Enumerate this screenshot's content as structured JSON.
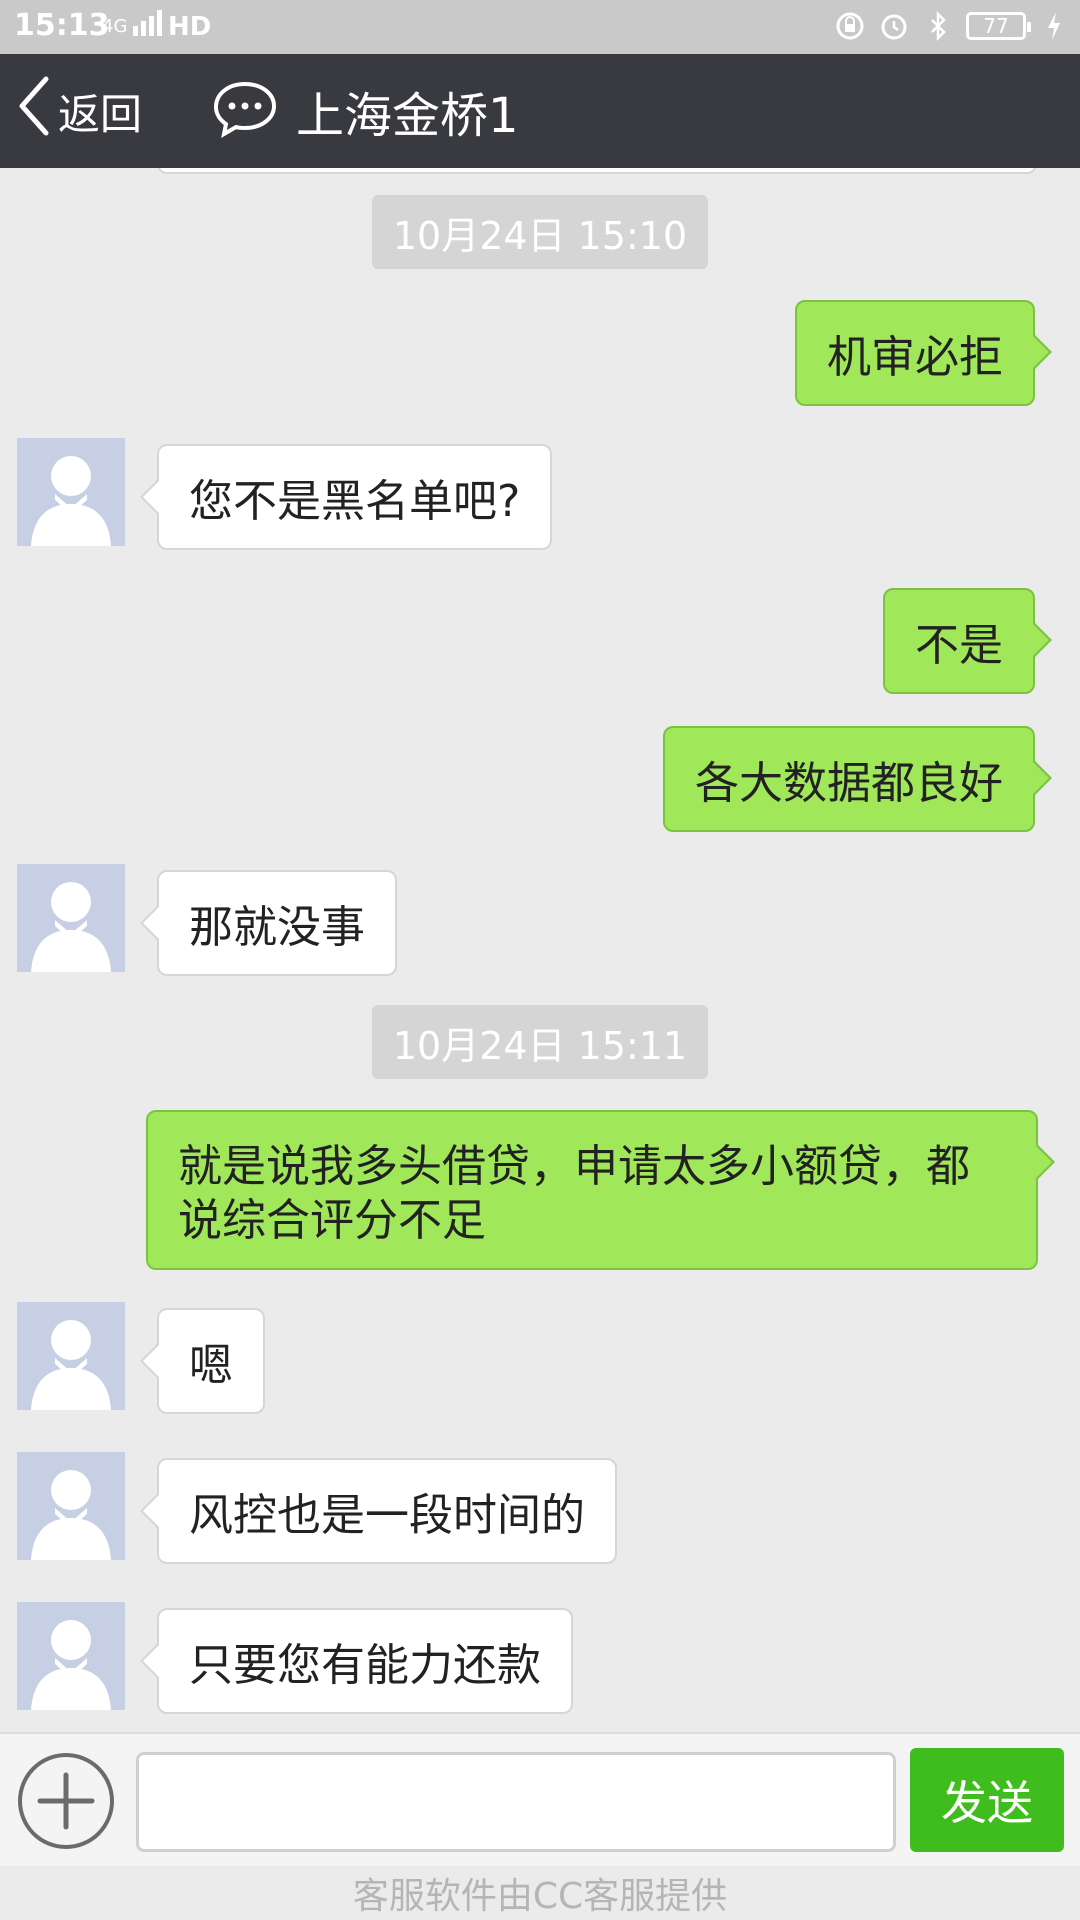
{
  "status_bar": {
    "time": "15:13",
    "network": "4G",
    "hd": "HD",
    "battery": "77"
  },
  "nav": {
    "back_label": "返回",
    "title": "上海金桥1"
  },
  "messages": [
    {
      "type": "time",
      "text": "10月24日 15:10"
    },
    {
      "type": "out",
      "text": "机审必拒"
    },
    {
      "type": "in",
      "text": "您不是黑名单吧?"
    },
    {
      "type": "out",
      "text": "不是"
    },
    {
      "type": "out",
      "text": "各大数据都良好"
    },
    {
      "type": "in",
      "text": "那就没事"
    },
    {
      "type": "time",
      "text": "10月24日 15:11"
    },
    {
      "type": "out",
      "text": "就是说我多头借贷，申请太多小额贷，都说综合评分不足"
    },
    {
      "type": "in",
      "text": "嗯"
    },
    {
      "type": "in",
      "text": "风控也是一段时间的"
    },
    {
      "type": "in",
      "text": "只要您有能力还款"
    }
  ],
  "input": {
    "value": "",
    "send_label": "发送"
  },
  "footer": {
    "text": "客服软件由CC客服提供"
  },
  "colors": {
    "nav_bg": "#393a3f",
    "outgoing_bubble": "#a0e75a",
    "incoming_bubble": "#ffffff",
    "send_button": "#3fbd1e",
    "chat_bg": "#ebebeb"
  }
}
